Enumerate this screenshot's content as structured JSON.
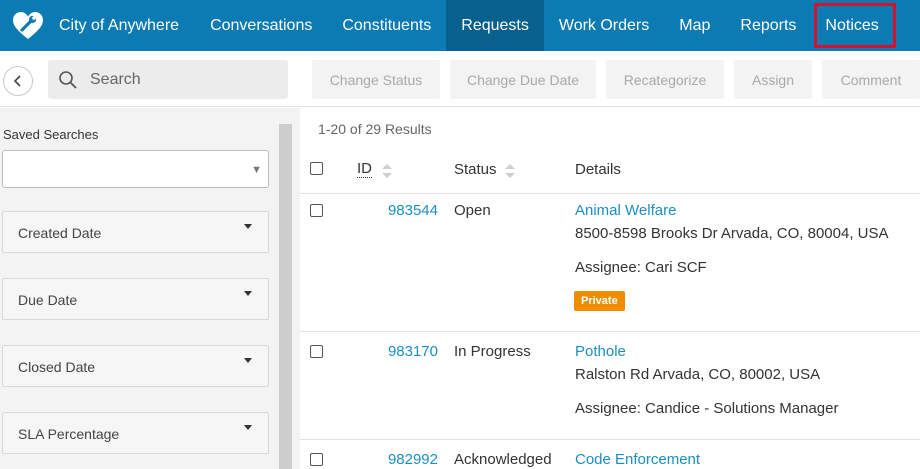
{
  "nav": {
    "brand": "City of Anywhere",
    "items": [
      "Conversations",
      "Constituents",
      "Requests",
      "Work Orders",
      "Map",
      "Reports",
      "Notices"
    ],
    "active": "Requests",
    "highlighted": "Notices"
  },
  "toolbar": {
    "search_placeholder": "Search",
    "actions": [
      "Change Status",
      "Change Due Date",
      "Recategorize",
      "Assign",
      "Comment"
    ]
  },
  "sidebar": {
    "saved_searches_label": "Saved Searches",
    "saved_searches_value": "",
    "filters": [
      "Created Date",
      "Due Date",
      "Closed Date",
      "SLA Percentage"
    ]
  },
  "results": {
    "count_text": "1-20 of 29 Results",
    "columns": {
      "id": "ID",
      "status": "Status",
      "details": "Details"
    },
    "rows": [
      {
        "id": "983544",
        "status": "Open",
        "category": "Animal Welfare",
        "address": "8500-8598 Brooks Dr Arvada, CO, 80004, USA",
        "assignee": "Assignee: Cari SCF",
        "badge": "Private"
      },
      {
        "id": "983170",
        "status": "In Progress",
        "category": "Pothole",
        "address": "Ralston Rd Arvada, CO, 80002, USA",
        "assignee": "Assignee: Candice - Solutions Manager"
      },
      {
        "id": "982992",
        "status": "Acknowledged",
        "category": "Code Enforcement"
      }
    ]
  },
  "colors": {
    "nav_bg": "#0c7ab3",
    "nav_active": "#08608e",
    "highlight_box": "#d3132c",
    "link": "#1a8fc1",
    "badge": "#f08c00"
  },
  "icons": {
    "logo": "heart-wrench-icon",
    "back": "chevron-left-icon",
    "search": "search-icon",
    "sort": "sort-icon"
  }
}
